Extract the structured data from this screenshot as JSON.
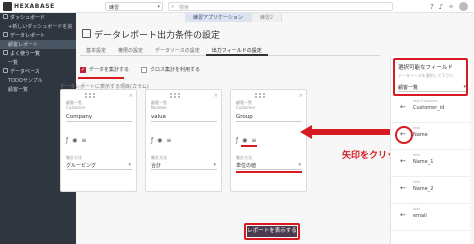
{
  "app": {
    "logo_text": "HEXABASE",
    "workspace": "練習",
    "search_placeholder": "検索"
  },
  "header": {
    "icons": [
      "help-icon",
      "bell-icon",
      "bird-icon",
      "avatar"
    ],
    "app_tabs": [
      "練習アプリケーション",
      "練習2"
    ]
  },
  "sidebar": {
    "items": [
      {
        "label": "ダッシュボード",
        "icon": "dashboard-icon"
      },
      {
        "label": "+新しいダッシュボードを追",
        "icon": ""
      },
      {
        "label": "データレポート",
        "icon": "report-icon"
      },
      {
        "label": "顧客レポート",
        "icon": ""
      },
      {
        "label": "よく使う一覧",
        "icon": "star-icon"
      },
      {
        "label": "一覧",
        "icon": ""
      },
      {
        "label": "データベース",
        "icon": "database-icon"
      },
      {
        "label": "TODOサンプル",
        "icon": ""
      },
      {
        "label": "顧客一覧",
        "icon": ""
      }
    ],
    "active_index": 3
  },
  "page": {
    "title": "データレポート出力条件の設定",
    "tabs": [
      "基本設定",
      "権限の設定",
      "データソースの設定",
      "出力フィールドの設定"
    ],
    "active_tab": 3,
    "aggregate_label": "データを集計する",
    "aggregate_checked": true,
    "cross_label": "クロス集計を利用する",
    "cross_checked": false,
    "hint": "データレポートに表示する項目(カラム)"
  },
  "cards": [
    {
      "meta1": "顧客一覧",
      "meta2": "Customer",
      "field": "Company",
      "agg_label": "集計方法",
      "agg_value": "グルーピング"
    },
    {
      "meta1": "顧客一覧",
      "meta2": "Number",
      "field": "value",
      "agg_label": "集計方法",
      "agg_value": "合計"
    },
    {
      "meta1": "顧客一覧",
      "meta2": "Customer",
      "field": "Group",
      "agg_label": "集計方法",
      "agg_value": "単位の値"
    }
  ],
  "annotation": "矢印をクリック",
  "right_panel": {
    "title": "選択可能なフィールド",
    "subtitle": "データソースを選択して下さい",
    "select_value": "顧客一覧",
    "items": [
      {
        "type": "text Customer",
        "name": "Customer_id"
      },
      {
        "type": "text",
        "name": "Name"
      },
      {
        "type": "text",
        "name": "Name_1"
      },
      {
        "type": "text",
        "name": "Name_2"
      },
      {
        "type": "text",
        "name": "email"
      }
    ]
  },
  "footer": {
    "show_button": "レポートを表示する"
  },
  "colors": {
    "accent_red": "#d81b20",
    "sidebar_bg": "#2f3640",
    "button_bg": "#4a3b4f"
  }
}
